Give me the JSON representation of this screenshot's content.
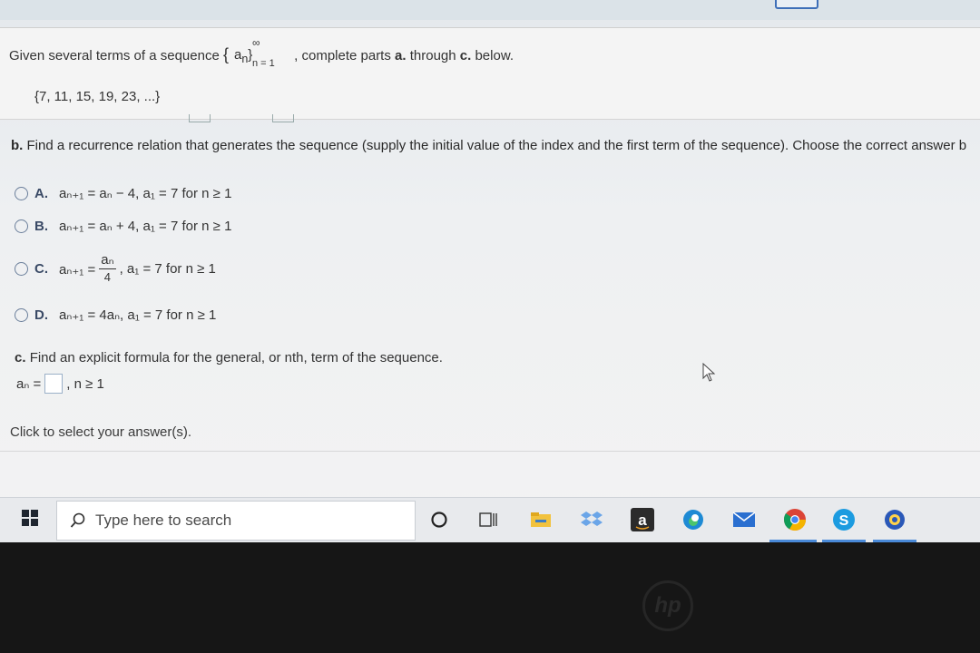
{
  "question": {
    "intro_prefix": "Given several terms of a sequence",
    "set_brace_open": "{",
    "set_term": "a",
    "set_term_sub": "n",
    "set_brace_close": "}",
    "set_upper": "∞",
    "set_lower": "n = 1",
    "intro_mid": ", complete parts",
    "part_a_ref": "a.",
    "intro_through": "through",
    "part_c_ref": "c.",
    "intro_end": "below.",
    "sequence": "{7, 11, 15, 19, 23, ...}"
  },
  "part_b": {
    "label": "b.",
    "prompt": "Find a recurrence relation that generates the sequence (supply the initial value of the index and the first term of the sequence). Choose the correct answer b",
    "options": [
      {
        "letter": "A.",
        "text": "aₙ₊₁ = aₙ − 4, a₁ = 7 for n ≥ 1"
      },
      {
        "letter": "B.",
        "text": "aₙ₊₁ = aₙ + 4, a₁ = 7 for n ≥ 1"
      },
      {
        "letter": "C.",
        "lhs": "aₙ₊₁ =",
        "frac_num": "aₙ",
        "frac_den": "4",
        "rhs": ", a₁ = 7 for n ≥ 1"
      },
      {
        "letter": "D.",
        "text": "aₙ₊₁ = 4aₙ, a₁ = 7 for n ≥ 1"
      }
    ]
  },
  "part_c": {
    "label": "c.",
    "prompt": "Find an explicit formula for the general, or nth, term of the sequence.",
    "lhs": "aₙ =",
    "rhs": ", n ≥ 1"
  },
  "footer": {
    "click_select": "Click to select your answer(s)."
  },
  "taskbar": {
    "search_placeholder": "Type here to search",
    "amazon_letter": "a",
    "skype_letter": "S",
    "hp_logo": "hp"
  },
  "colors": {
    "accent": "#4a8ad8",
    "option_letter": "#3a4a66"
  }
}
